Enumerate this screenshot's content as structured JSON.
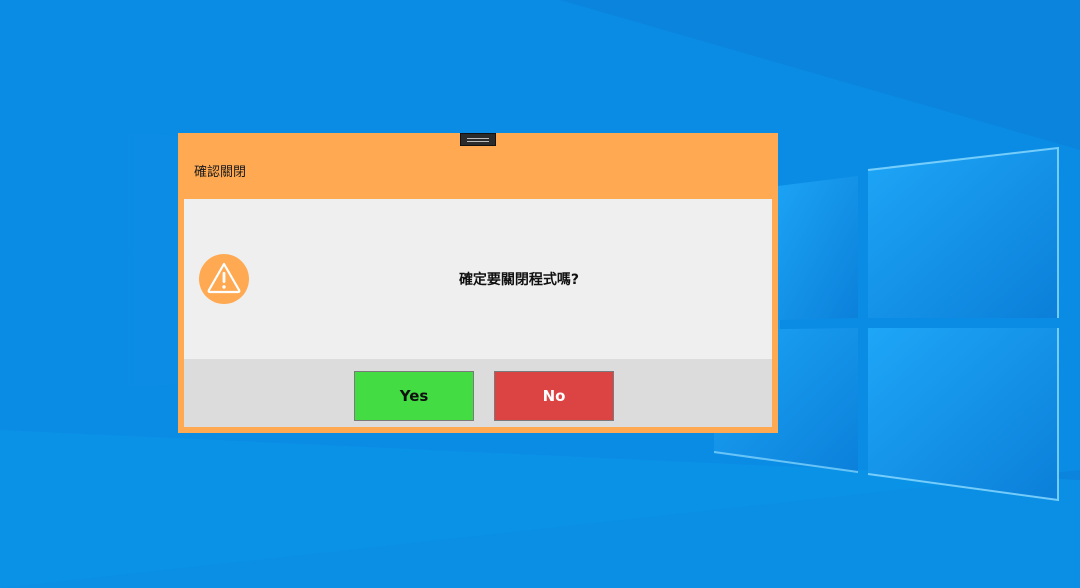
{
  "dialog": {
    "title": "確認關閉",
    "message": "確定要關閉程式嗎?",
    "icon": "warning-icon",
    "yes_label": "Yes",
    "no_label": "No"
  },
  "colors": {
    "dialog_frame": "#ffa952",
    "body_bg": "#efefef",
    "button_bar_bg": "#dcdcdc",
    "yes_button": "#43dd43",
    "no_button": "#dc4444",
    "desktop_bg": "#0a86de"
  }
}
